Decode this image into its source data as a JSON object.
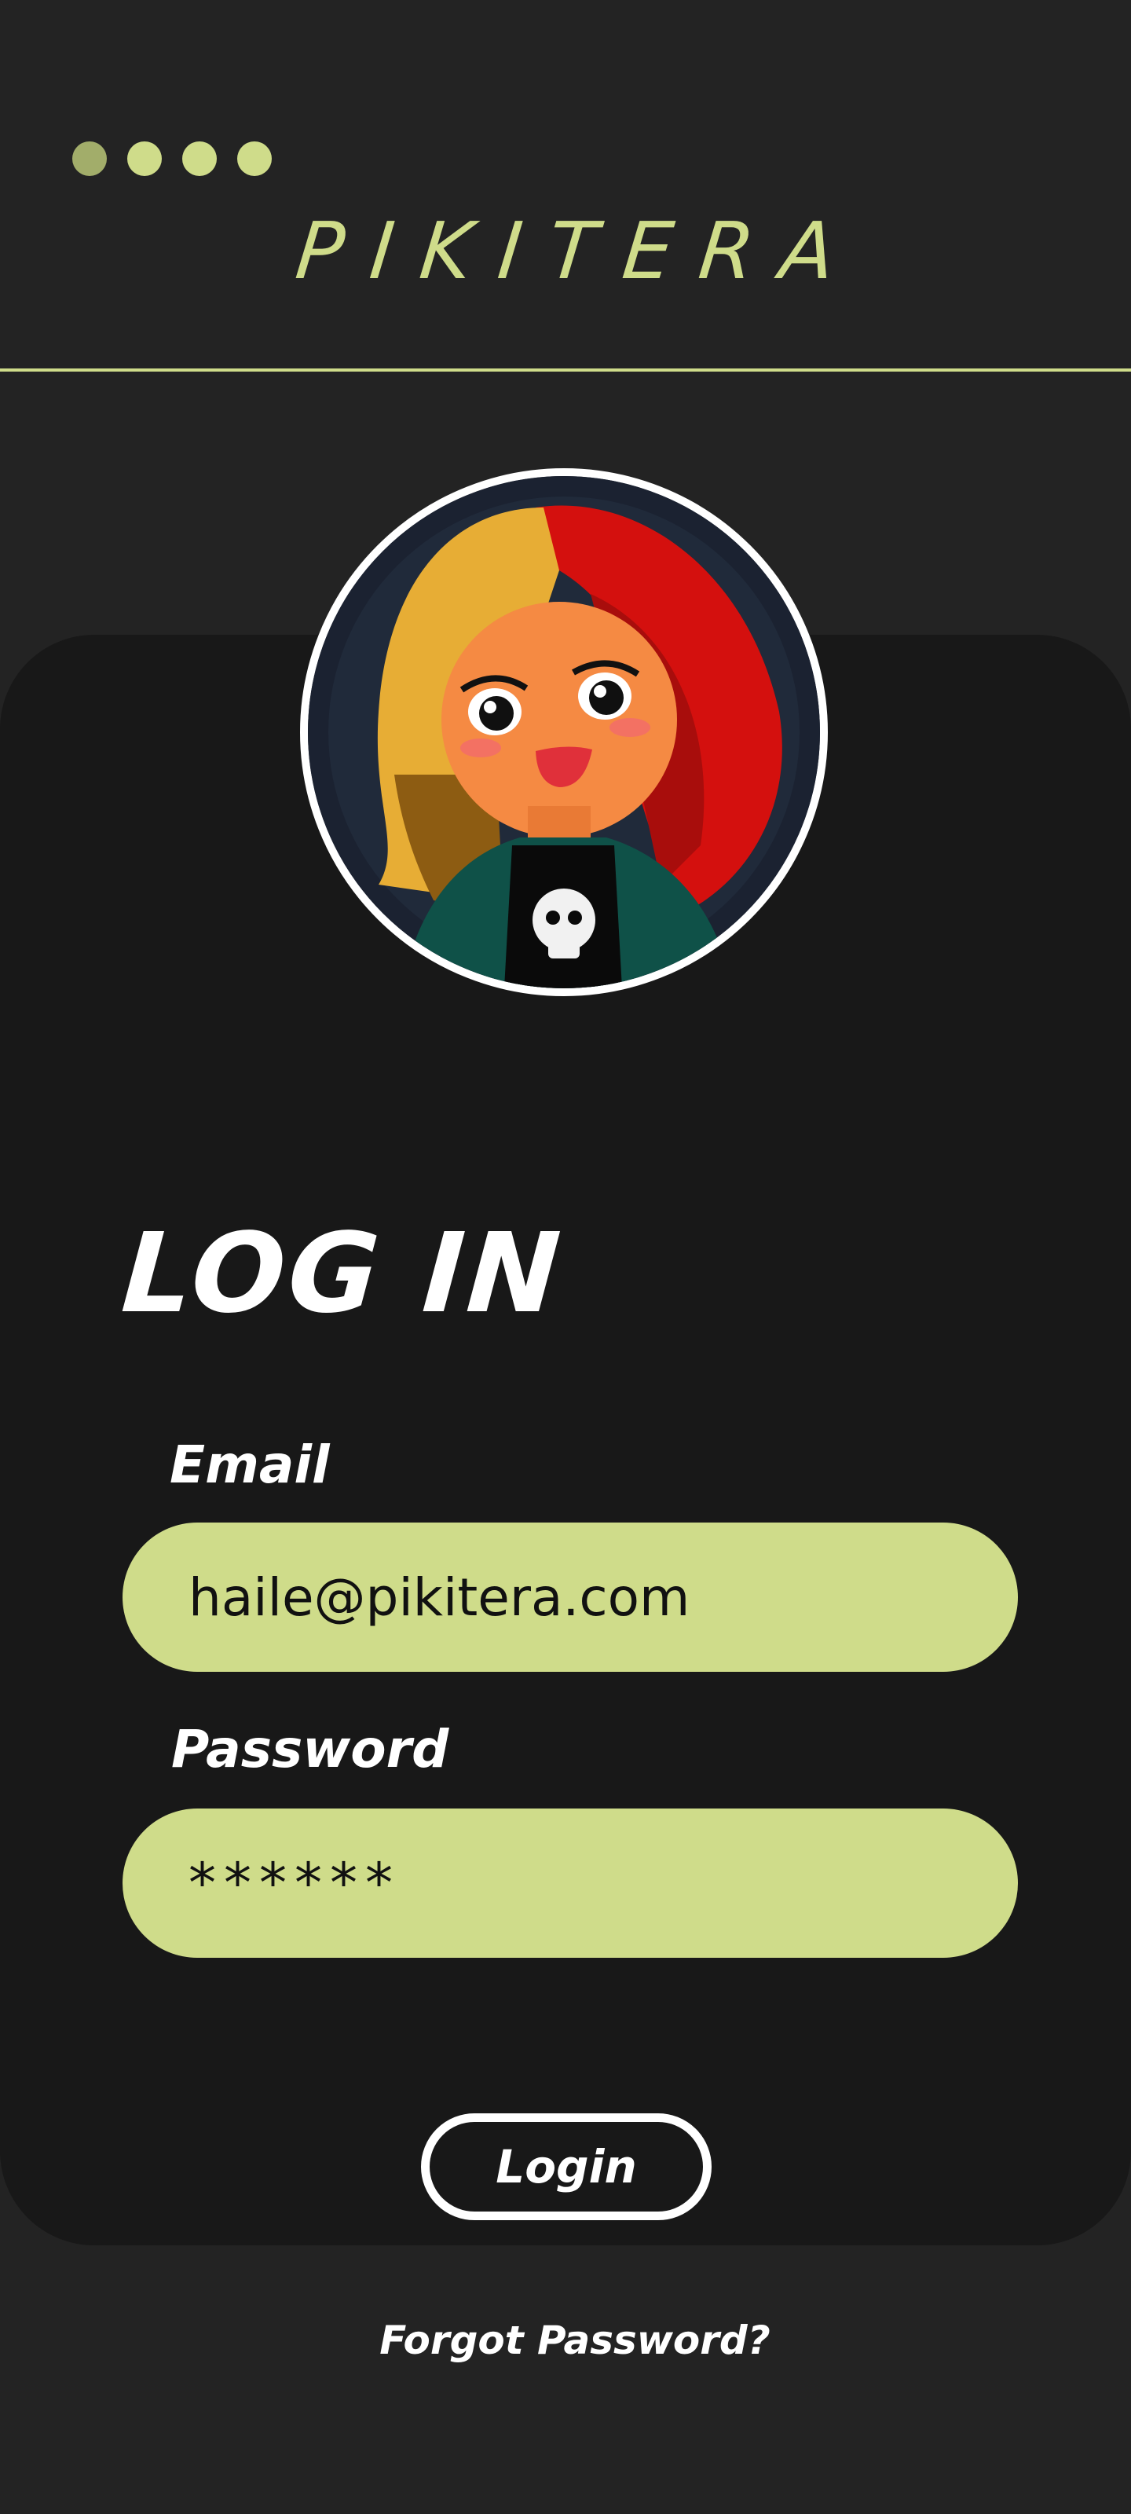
{
  "colors": {
    "background": "#232323",
    "card": "#181818",
    "accent": "#cfdc8a",
    "text": "#ffffff",
    "field_text": "#111111",
    "dot_active": "#a2ad6a"
  },
  "header": {
    "brand": "PIKITERA",
    "dots": [
      {
        "name": "page-dot-1",
        "active": true
      },
      {
        "name": "page-dot-2",
        "active": false
      },
      {
        "name": "page-dot-3",
        "active": false
      },
      {
        "name": "page-dot-4",
        "active": false
      }
    ]
  },
  "avatar": {
    "icon": "user-avatar-illustration"
  },
  "form": {
    "title": "LOG IN",
    "email_label": "Email",
    "email_value": "haile@pikitera.com",
    "password_label": "Password",
    "password_value": "******",
    "login_label": "Login",
    "forgot_label": "Forgot Password?"
  }
}
